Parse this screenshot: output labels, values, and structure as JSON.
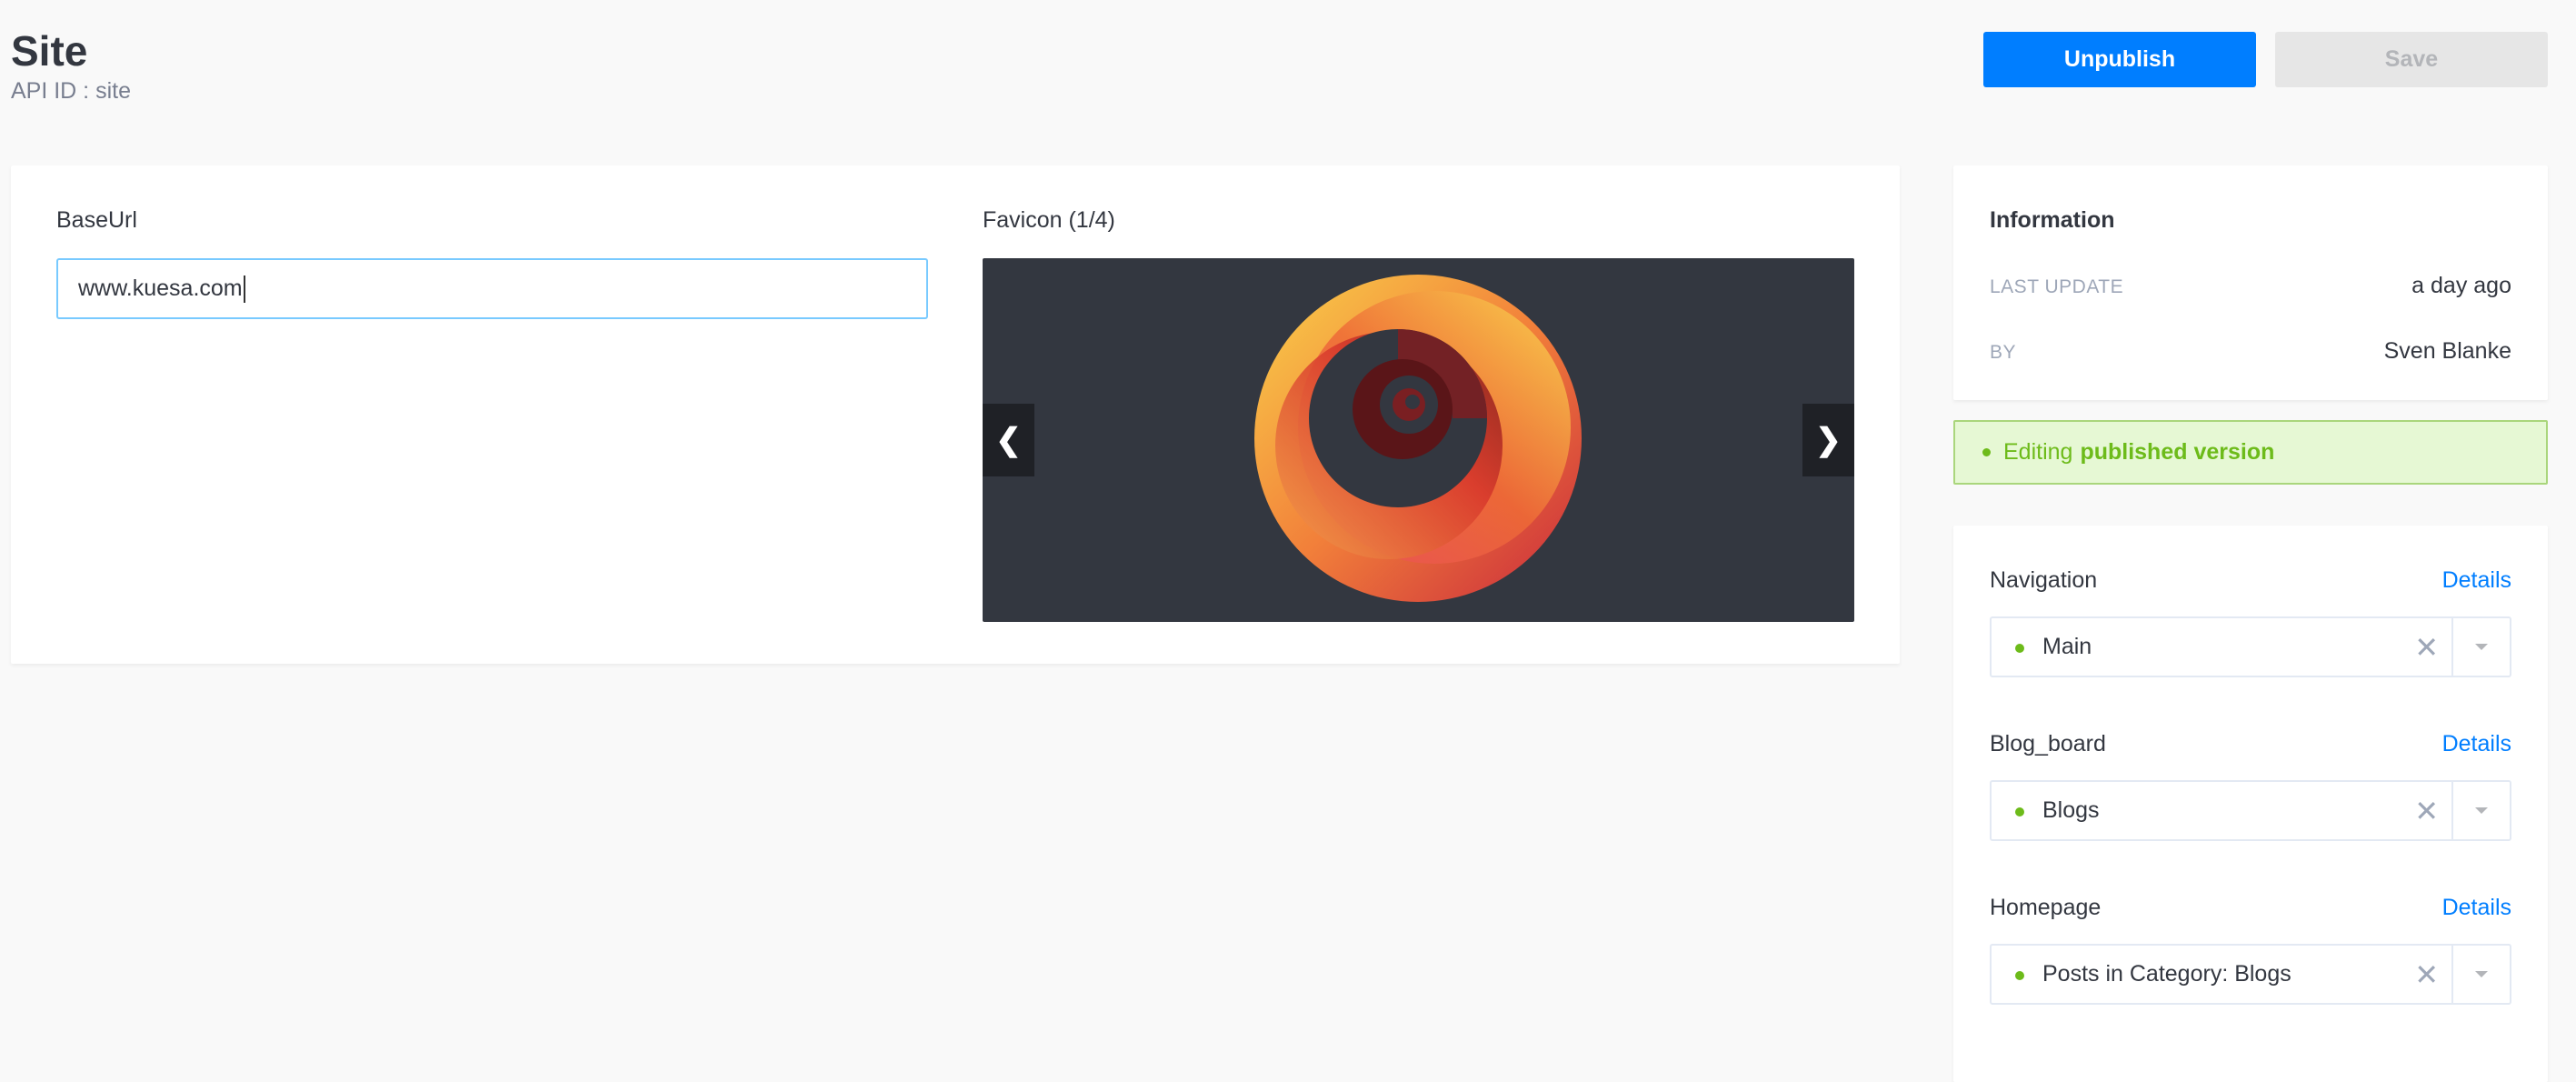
{
  "header": {
    "title": "Site",
    "api_id": "API ID : site"
  },
  "actions": {
    "unpublish_label": "Unpublish",
    "save_label": "Save"
  },
  "form": {
    "baseurl": {
      "label": "BaseUrl",
      "value": "www.kuesa.com"
    },
    "favicon": {
      "label": "Favicon (1/4)",
      "prev_icon": "chevron-left-icon",
      "next_icon": "chevron-right-icon"
    }
  },
  "information": {
    "title": "Information",
    "last_update_key": "LAST UPDATE",
    "last_update_value": "a day ago",
    "by_key": "BY",
    "by_value": "Sven Blanke"
  },
  "status": {
    "prefix": "Editing",
    "highlight": "published version"
  },
  "relations": [
    {
      "label": "Navigation",
      "link": "Details",
      "value": "Main"
    },
    {
      "label": "Blog_board",
      "link": "Details",
      "value": "Blogs"
    },
    {
      "label": "Homepage",
      "link": "Details",
      "value": "Posts in Category: Blogs"
    }
  ],
  "colors": {
    "primary": "#007eff",
    "success": "#6dbb1a",
    "status_bg": "#e6f8d4",
    "viewer_bg": "#333740"
  }
}
